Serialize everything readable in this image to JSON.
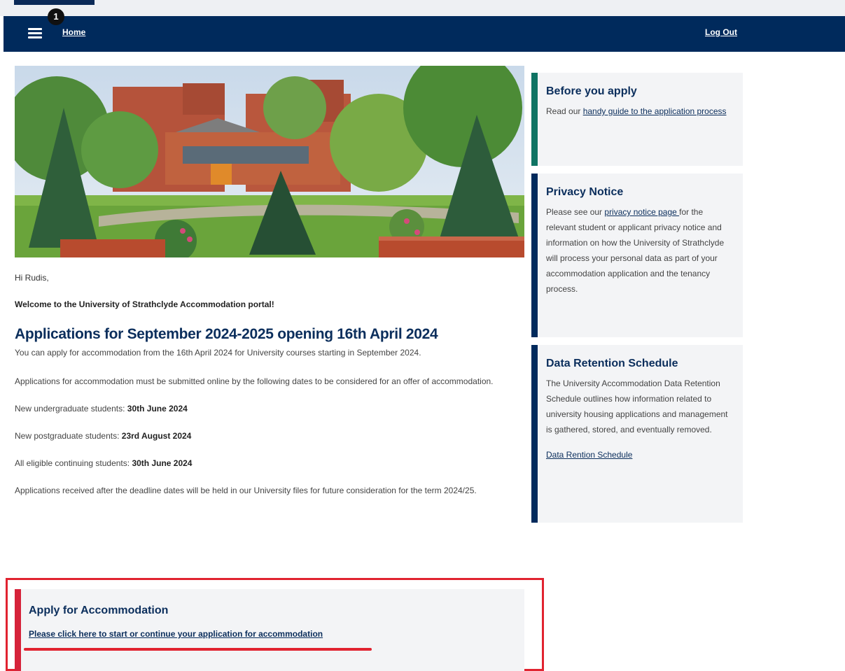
{
  "nav": {
    "badge_count": "1",
    "home_label": "Home",
    "logout_label": "Log Out"
  },
  "main": {
    "greeting": "Hi Rudis,",
    "welcome": "Welcome to the University of Strathclyde Accommodation portal!",
    "heading": "Applications for September 2024-2025 opening 16th April 2024",
    "intro": "You can apply for accommodation from the 16th April 2024 for University courses starting in September 2024.",
    "deadline_intro": "Applications for accommodation must be submitted online by the following dates to be considered for an offer of accommodation.",
    "deadlines": [
      {
        "label": "New undergraduate students: ",
        "date": "30th June 2024"
      },
      {
        "label": "New postgraduate students: ",
        "date": "23rd August 2024"
      },
      {
        "label": "All eligible continuing students: ",
        "date": "30th June 2024"
      }
    ],
    "late_note": "Applications received after the deadline dates will be held in our University files for future consideration for the term 2024/25."
  },
  "apply": {
    "title": "Apply for Accommodation",
    "link": "Please click here to start or continue your application for accommodation"
  },
  "sidebar": {
    "before": {
      "title": "Before you apply",
      "text_prefix": "Read our ",
      "link": "handy guide to the application process"
    },
    "privacy": {
      "title": "Privacy Notice",
      "text_prefix": "Please see our ",
      "link": "privacy notice page ",
      "text_suffix": "for the relevant student or applicant privacy notice and information on how the University of Strathclyde will process your personal data as part of your accommodation application and the tenancy process."
    },
    "retention": {
      "title": "Data Retention Schedule",
      "text": "The University Accommodation Data Retention Schedule outlines how information related to university housing applications and management is gathered, stored, and eventually removed.",
      "link": "Data Rention Schedule"
    }
  },
  "colors": {
    "nav_bg": "#002a5c",
    "heading": "#0b2e5c",
    "accent_red": "#e12330",
    "accent_teal": "#0f7363"
  }
}
